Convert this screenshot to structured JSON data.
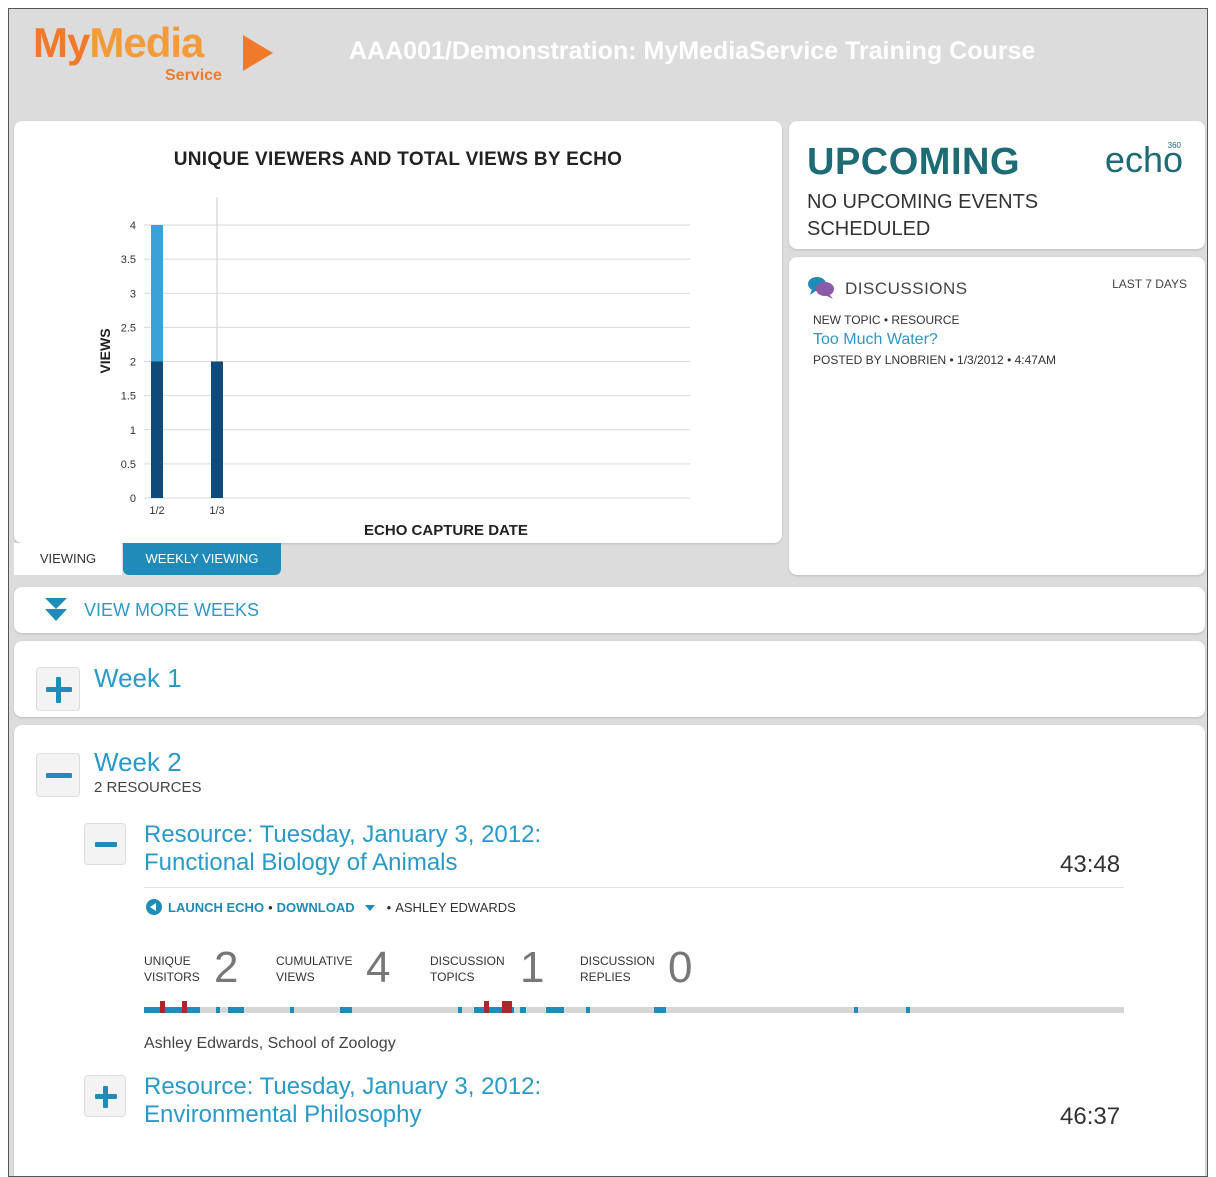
{
  "header": {
    "logo_main_1": "My",
    "logo_main_2": "Media",
    "logo_service": "Service",
    "course_title": "AAA001/Demonstration: MyMediaService Training Course"
  },
  "chart_panel": {
    "title": "UNIQUE VIEWERS AND TOTAL VIEWS BY ECHO",
    "tabs": [
      {
        "label": "VIEWING",
        "active": false
      },
      {
        "label": "WEEKLY VIEWING",
        "active": true
      }
    ]
  },
  "chart_data": {
    "type": "bar",
    "title": "UNIQUE VIEWERS AND TOTAL VIEWS BY ECHO",
    "xlabel": "ECHO CAPTURE DATE",
    "ylabel": "VIEWS",
    "categories": [
      "1/2",
      "1/3"
    ],
    "series": [
      {
        "values": [
          2,
          2
        ],
        "color": "#0e4a7a"
      },
      {
        "values": [
          2,
          0
        ],
        "color": "#3aa2d8"
      }
    ],
    "stacked": true,
    "ylim": [
      0,
      4
    ],
    "yticks": [
      "0",
      "0.5",
      "1",
      "1.5",
      "2",
      "2.5",
      "3",
      "3.5",
      "4"
    ],
    "grid": true
  },
  "upcoming": {
    "title": "UPCOMING",
    "text": "NO UPCOMING EVENTS SCHEDULED",
    "logo_text": "echo",
    "logo_sup": "360"
  },
  "discussions": {
    "title": "DISCUSSIONS",
    "range": "LAST 7 DAYS",
    "meta": "NEW TOPIC • RESOURCE",
    "topic_link": "Too Much Water?",
    "posted": "POSTED BY LNOBRIEN • 1/3/2012 • 4:47AM"
  },
  "view_more": {
    "label": "VIEW MORE WEEKS"
  },
  "weeks": [
    {
      "title": "Week 1",
      "expanded": false
    },
    {
      "title": "Week 2",
      "subtitle": "2 RESOURCES",
      "expanded": true,
      "resources": [
        {
          "title_line1": "Resource: Tuesday, January 3, 2012:",
          "title_line2": "Functional Biology of Animals",
          "duration": "43:48",
          "launch_label": "LAUNCH ECHO",
          "download_label": "DOWNLOAD",
          "presenter": "ASHLEY EDWARDS",
          "stats": [
            {
              "label": "UNIQUE VISITORS",
              "value": "2"
            },
            {
              "label": "CUMULATIVE VIEWS",
              "value": "4"
            },
            {
              "label": "DISCUSSION TOPICS",
              "value": "1"
            },
            {
              "label": "DISCUSSION REPLIES",
              "value": "0"
            }
          ],
          "author_line": "Ashley Edwards, School of Zoology",
          "expanded": true
        },
        {
          "title_line1": "Resource: Tuesday, January 3, 2012:",
          "title_line2": "Environmental Philosophy",
          "duration": "46:37",
          "expanded": false
        }
      ]
    }
  ],
  "colors": {
    "accent": "#1f8bb8",
    "link": "#2a9ac8",
    "brand_orange": "#f07a2a",
    "echo_teal": "#1d6b74",
    "marker_red": "#a72a2a"
  }
}
